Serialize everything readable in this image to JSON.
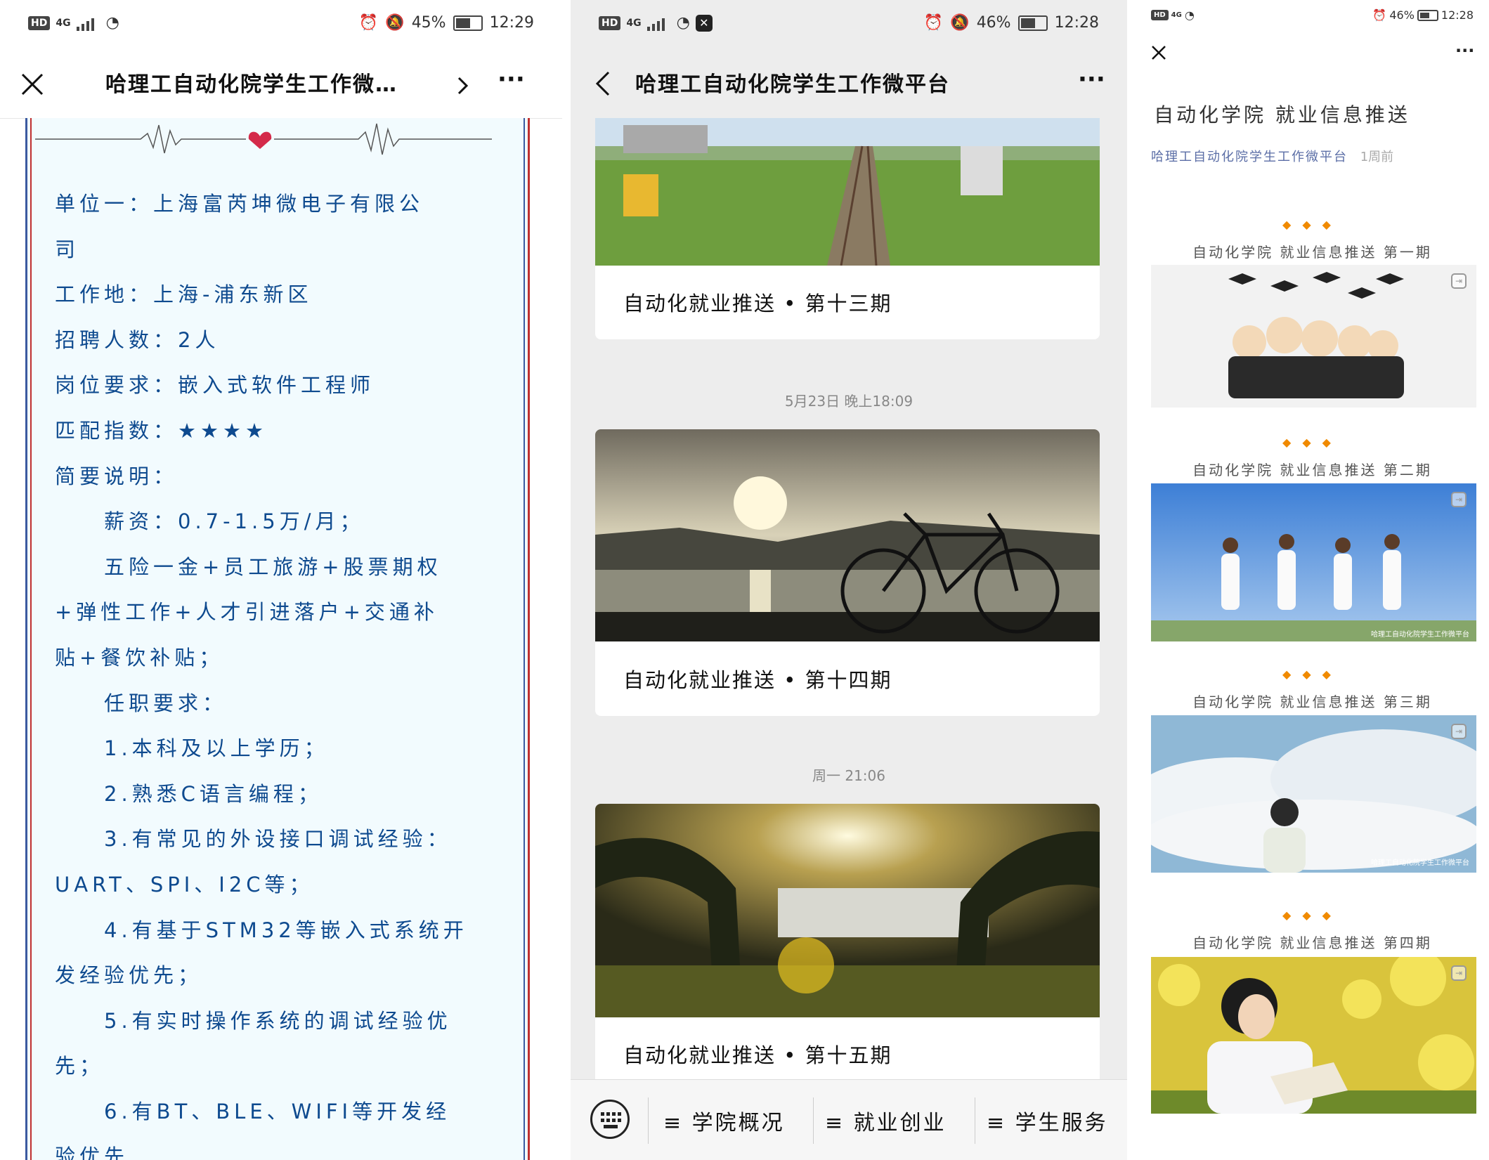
{
  "panel1": {
    "status": {
      "net": "4G",
      "battery": "45%",
      "time": "12:29"
    },
    "nav": {
      "title": "哈理工自动化院学生工作微…",
      "more": "···"
    },
    "job_lines": [
      "单位一：上海富芮坤微电子有限公",
      "司",
      "工作地：上海-浦东新区",
      "招聘人数：2人",
      "岗位要求：嵌入式软件工程师",
      "匹配指数：★★★★",
      "简要说明：",
      "薪资：0.7-1.5万/月；",
      "五险一金+员工旅游+股票期权",
      "+弹性工作+人才引进落户+交通补",
      "贴+餐饮补贴；",
      "任职要求：",
      "1.本科及以上学历；",
      "2.熟悉C语言编程；",
      "3.有常见的外设接口调试经验：",
      "UART、SPI、I2C等；",
      "4.有基于STM32等嵌入式系统开",
      "发经验优先；",
      "5.有实时操作系统的调试经验优",
      "先；",
      "6.有BT、BLE、WIFI等开发经",
      "验优先"
    ]
  },
  "panel2": {
    "status": {
      "net": "4G",
      "battery": "46%",
      "time": "12:28"
    },
    "nav": {
      "title": "哈理工自动化院学生工作微平台",
      "more": "···"
    },
    "cards": [
      {
        "caption": "自动化就业推送 • 第十三期"
      },
      {
        "caption": "自动化就业推送 • 第十四期"
      },
      {
        "caption": "自动化就业推送 • 第十五期"
      }
    ],
    "timestamps": [
      "5月23日 晚上18:09",
      "周一 21:06"
    ],
    "menu": [
      "≡ 学院概况",
      "≡ 就业创业",
      "≡ 学生服务"
    ]
  },
  "panel3": {
    "status": {
      "net": "4G",
      "battery": "46%",
      "time": "12:28"
    },
    "nav": {
      "more": "···"
    },
    "title": "自动化学院 就业信息推送",
    "author": "哈理工自动化院学生工作微平台",
    "time_ago": "1周前",
    "dots": "◆◆◆",
    "issues": [
      "自动化学院 就业信息推送 第一期",
      "自动化学院 就业信息推送 第二期",
      "自动化学院 就业信息推送 第三期",
      "自动化学院 就业信息推送 第四期"
    ],
    "watermark": "哈理工自动化院学生工作微平台"
  },
  "colors": {
    "job_text": "#0e4a8f",
    "accent_orange": "#f08a00",
    "author_blue": "#5b6ea6"
  }
}
